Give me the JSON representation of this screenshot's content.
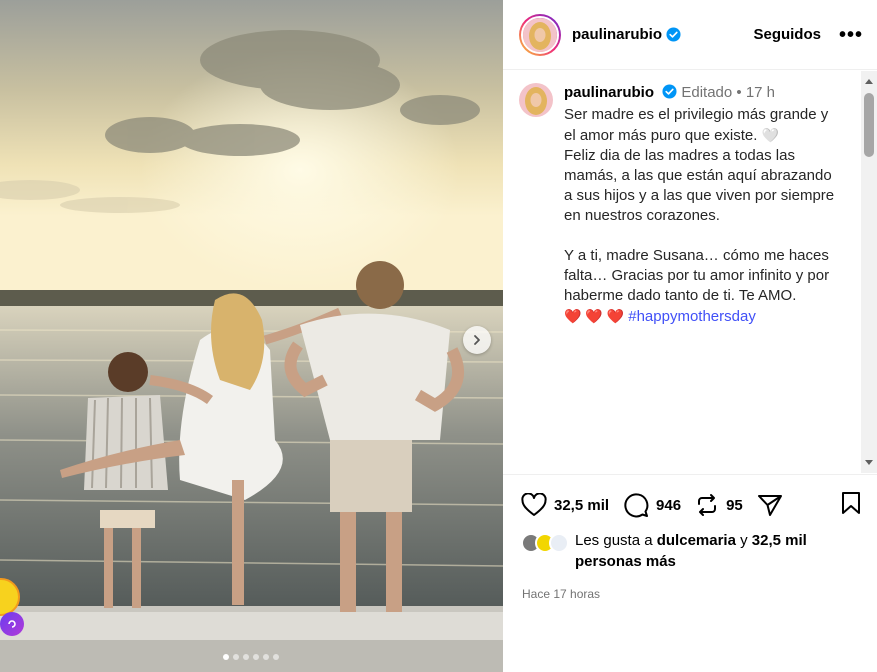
{
  "post": {
    "username": "paulinarubio",
    "follow_label": "Seguidos",
    "more_label": "•••"
  },
  "caption": {
    "username": "paulinarubio",
    "edited_label": "Editado",
    "separator": "•",
    "time_ago": "17 h",
    "line1": "Ser madre es el privilegio más grande y el amor más puro que existe.",
    "line1_emoji": "🤍",
    "line2": "Feliz dia de las madres a todas las mamás, a las que están aquí abrazando a sus hijos y a las que viven por siempre en nuestros corazones.",
    "line3": "Y a ti, madre Susana… cómo me haces falta… Gracias por tu amor infinito y por haberme dado tanto de ti. Te AMO.",
    "hearts": "❤️ ❤️ ❤️",
    "hashtag": "#happymothersday"
  },
  "actions": {
    "likes_count": "32,5 mil",
    "comments_count": "946",
    "reposts_count": "95"
  },
  "likes": {
    "prefix": "Les gusta a",
    "user": "dulcemaria",
    "connector": "y",
    "others": "32,5 mil personas más"
  },
  "timestamp": "Hace 17 horas",
  "carousel": {
    "slides": 6,
    "active_index": 0
  },
  "colors": {
    "verified": "#0095f6",
    "hashtag": "#4150f7",
    "heart": "#e0245e"
  },
  "icons": [
    "heart-icon",
    "comment-icon",
    "repost-icon",
    "share-icon",
    "bookmark-icon",
    "verified-icon",
    "chevron-right-icon",
    "more-icon"
  ]
}
